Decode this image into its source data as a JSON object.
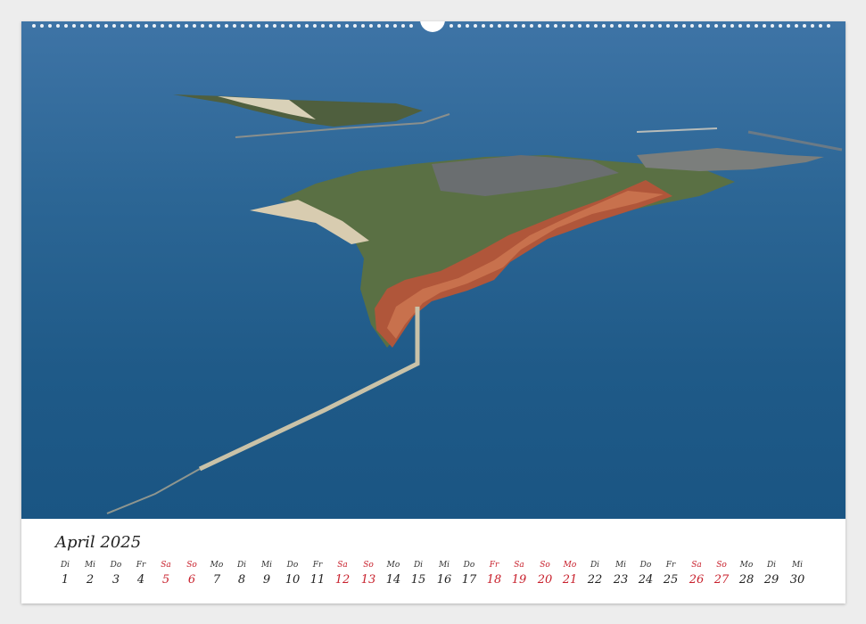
{
  "calendar": {
    "month_label": "April 2025",
    "weekend_color": "#c8202c",
    "days": [
      {
        "wd": "Di",
        "n": "1",
        "red": false
      },
      {
        "wd": "Mi",
        "n": "2",
        "red": false
      },
      {
        "wd": "Do",
        "n": "3",
        "red": false
      },
      {
        "wd": "Fr",
        "n": "4",
        "red": false
      },
      {
        "wd": "Sa",
        "n": "5",
        "red": true
      },
      {
        "wd": "So",
        "n": "6",
        "red": true
      },
      {
        "wd": "Mo",
        "n": "7",
        "red": false
      },
      {
        "wd": "Di",
        "n": "8",
        "red": false
      },
      {
        "wd": "Mi",
        "n": "9",
        "red": false
      },
      {
        "wd": "Do",
        "n": "10",
        "red": false
      },
      {
        "wd": "Fr",
        "n": "11",
        "red": false
      },
      {
        "wd": "Sa",
        "n": "12",
        "red": true
      },
      {
        "wd": "So",
        "n": "13",
        "red": true
      },
      {
        "wd": "Mo",
        "n": "14",
        "red": false
      },
      {
        "wd": "Di",
        "n": "15",
        "red": false
      },
      {
        "wd": "Mi",
        "n": "16",
        "red": false
      },
      {
        "wd": "Do",
        "n": "17",
        "red": false
      },
      {
        "wd": "Fr",
        "n": "18",
        "red": true
      },
      {
        "wd": "Sa",
        "n": "19",
        "red": true
      },
      {
        "wd": "So",
        "n": "20",
        "red": true
      },
      {
        "wd": "Mo",
        "n": "21",
        "red": true
      },
      {
        "wd": "Di",
        "n": "22",
        "red": false
      },
      {
        "wd": "Mi",
        "n": "23",
        "red": false
      },
      {
        "wd": "Do",
        "n": "24",
        "red": false
      },
      {
        "wd": "Fr",
        "n": "25",
        "red": false
      },
      {
        "wd": "Sa",
        "n": "26",
        "red": true
      },
      {
        "wd": "So",
        "n": "27",
        "red": true
      },
      {
        "wd": "Mo",
        "n": "28",
        "red": false
      },
      {
        "wd": "Di",
        "n": "29",
        "red": false
      },
      {
        "wd": "Mi",
        "n": "30",
        "red": false
      }
    ]
  }
}
